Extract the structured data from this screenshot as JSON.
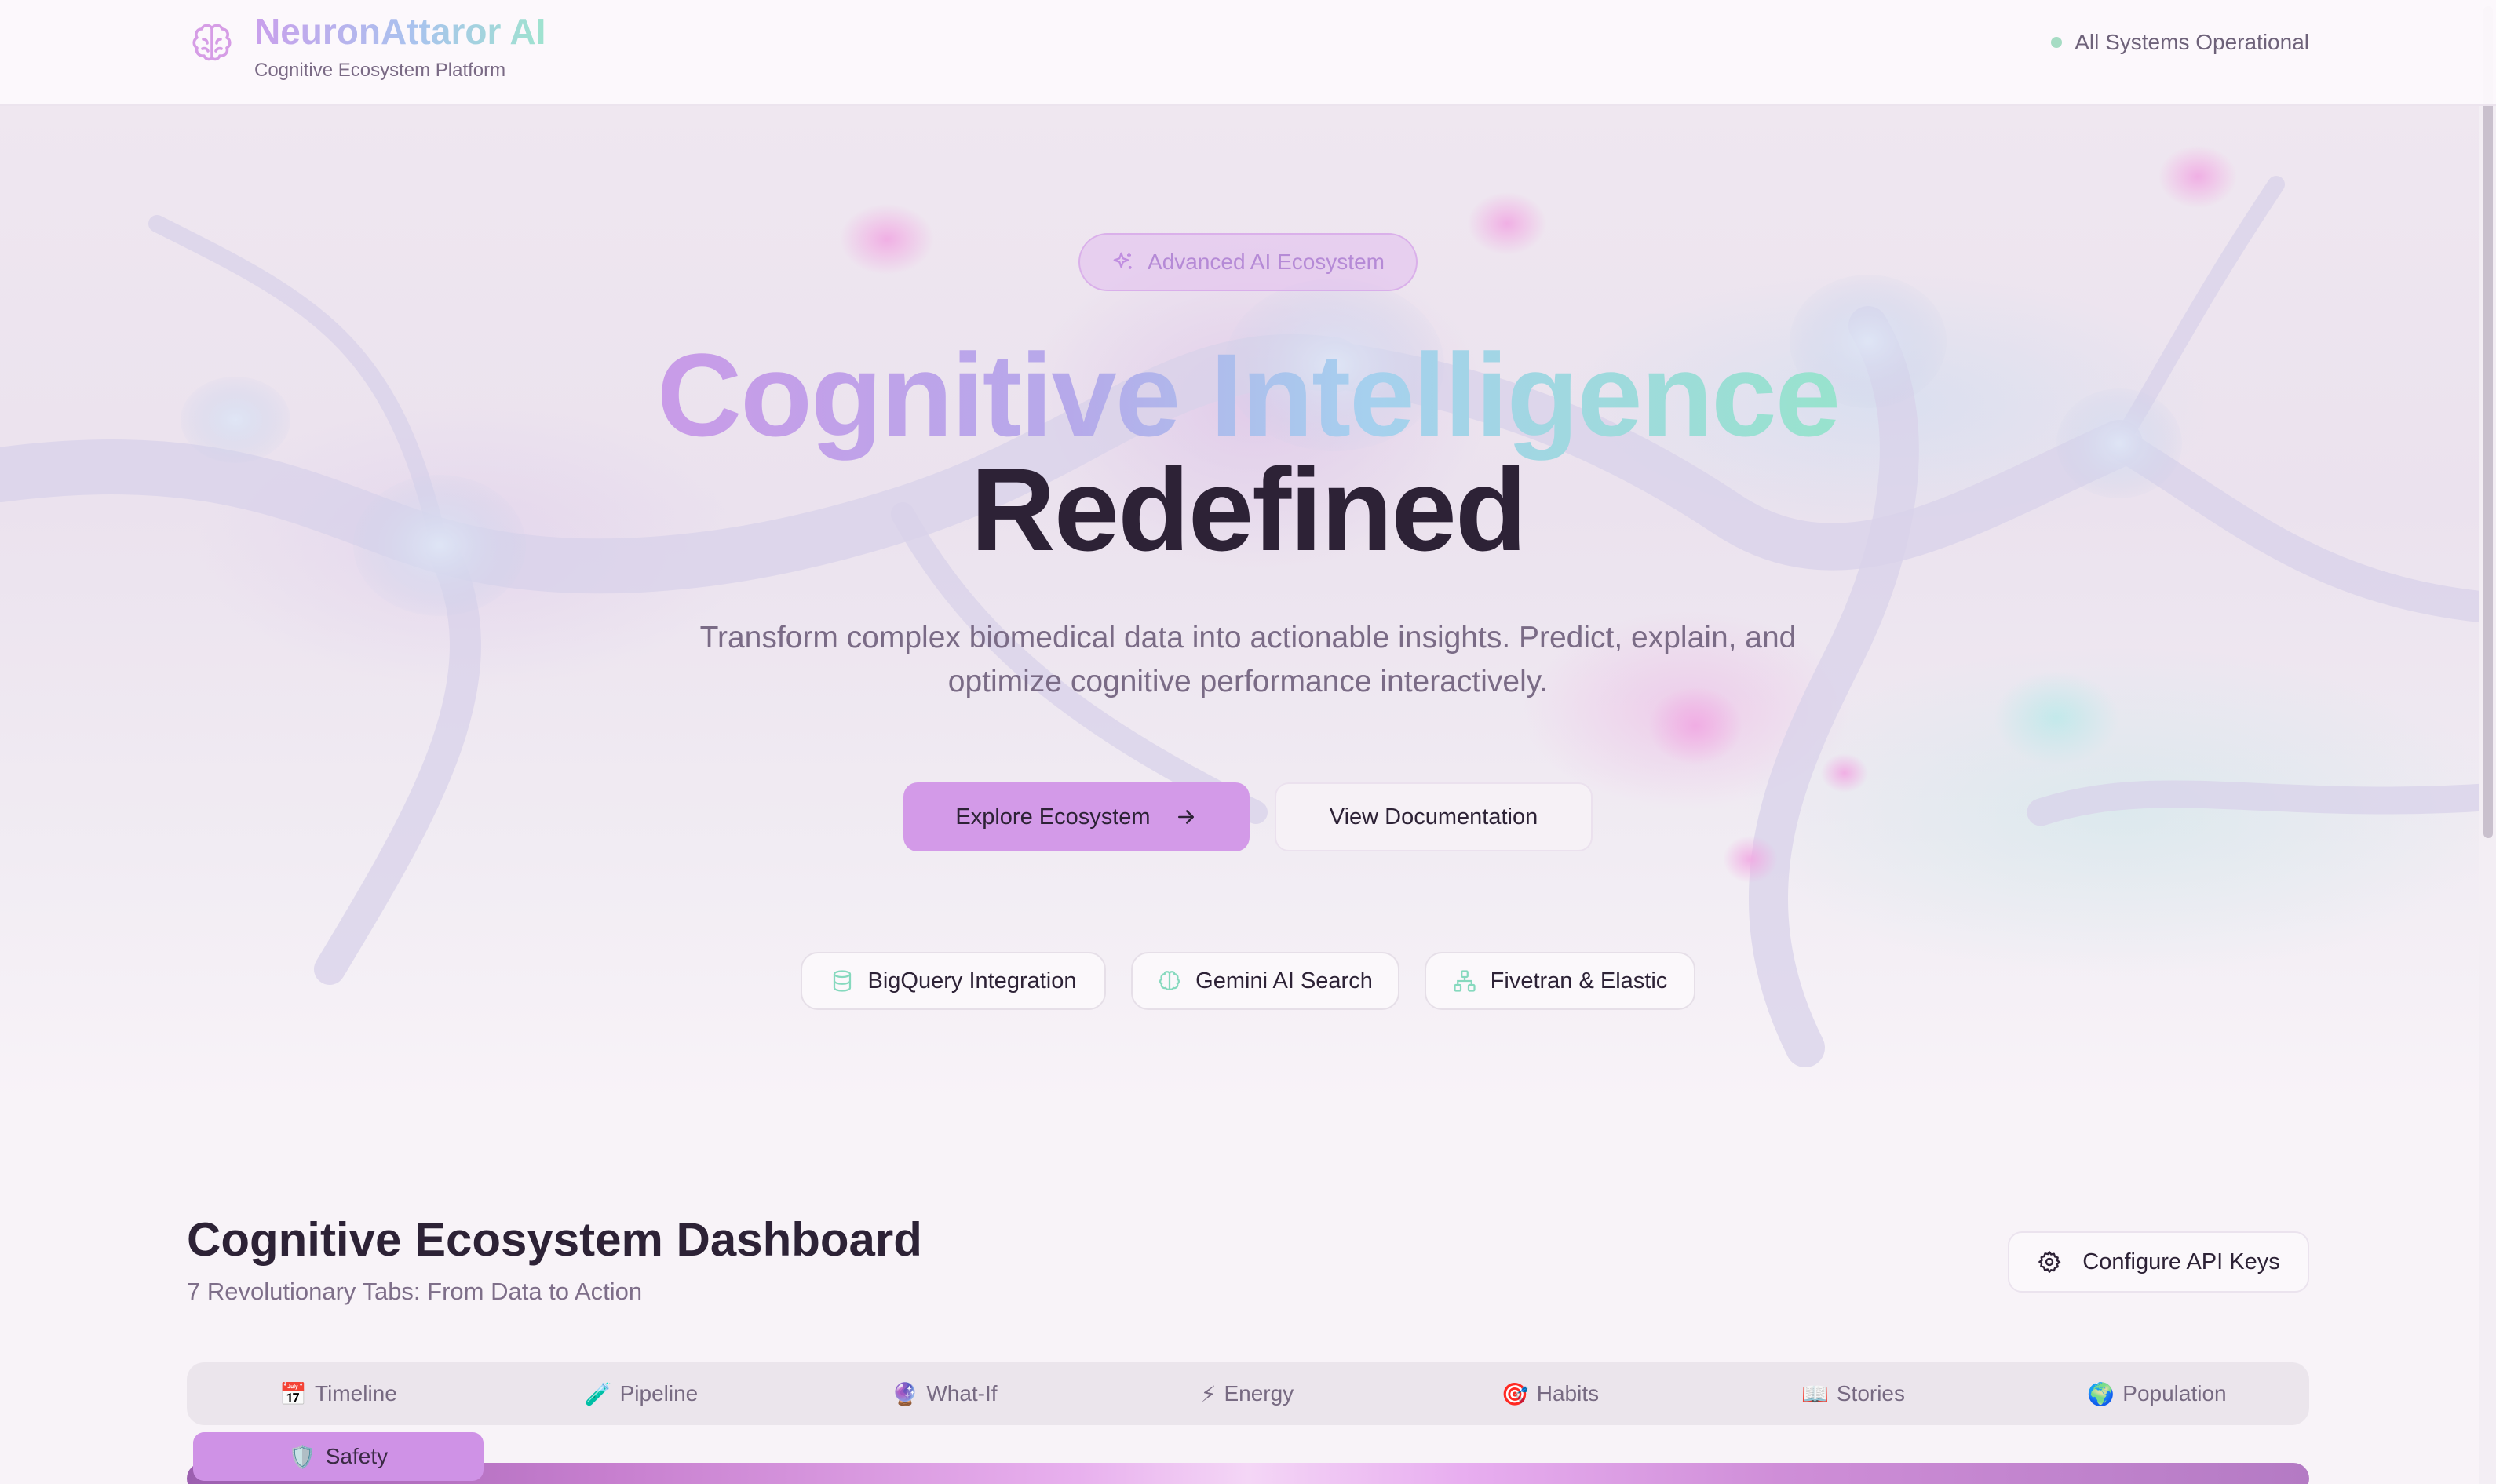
{
  "header": {
    "brand_name": "NeuronAttaror AI",
    "brand_tagline": "Cognitive Ecosystem Platform",
    "status_text": "All Systems Operational",
    "logo_icon": "brain-icon"
  },
  "hero": {
    "badge_label": "Advanced AI Ecosystem",
    "title_gradient": "Cognitive Intelligence",
    "title_dark": "Redefined",
    "description": "Transform complex biomedical data into actionable insights. Predict, explain, and optimize cognitive performance interactively.",
    "primary_button": "Explore Ecosystem",
    "secondary_button": "View Documentation",
    "features": [
      {
        "label": "BigQuery Integration",
        "icon": "database-icon"
      },
      {
        "label": "Gemini AI Search",
        "icon": "brain-icon"
      },
      {
        "label": "Fivetran & Elastic",
        "icon": "network-icon"
      }
    ]
  },
  "dashboard": {
    "title": "Cognitive Ecosystem Dashboard",
    "subtitle": "7 Revolutionary Tabs: From Data to Action",
    "api_button": "Configure API Keys",
    "tabs": [
      {
        "emoji": "📅",
        "label": "Timeline"
      },
      {
        "emoji": "🧪",
        "label": "Pipeline"
      },
      {
        "emoji": "🔮",
        "label": "What-If"
      },
      {
        "emoji": "⚡",
        "label": "Energy"
      },
      {
        "emoji": "🎯",
        "label": "Habits"
      },
      {
        "emoji": "📖",
        "label": "Stories"
      },
      {
        "emoji": "🌍",
        "label": "Population"
      }
    ],
    "active_tab": {
      "emoji": "🛡️",
      "label": "Safety"
    }
  },
  "colors": {
    "accent": "#d39ae8",
    "status_green": "#a6dcc4",
    "text_dark": "#2d2236",
    "text_muted": "#7a6b86"
  }
}
